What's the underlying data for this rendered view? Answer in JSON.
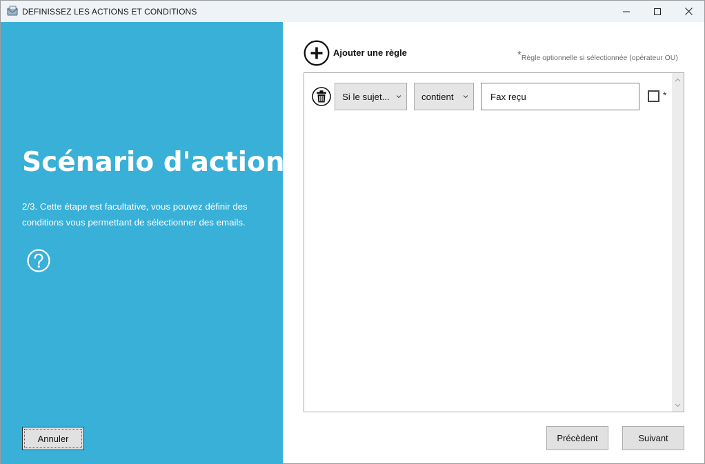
{
  "window": {
    "title": "DEFINISSEZ LES ACTIONS ET CONDITIONS",
    "controls": [
      "minimize-icon",
      "maximize-icon",
      "close-icon"
    ]
  },
  "left_panel": {
    "background_color": "#38b0d7",
    "title": "Scénario d'actions",
    "description": "2/3. Cette étape est facultative, vous pouvez définir des conditions vous permettant de sélectionner des emails.",
    "help_icon": "question-circle-icon",
    "cancel_label": "Annuler"
  },
  "right_panel": {
    "add_rule_label": "Ajouter une règle",
    "add_rule_icon": "plus-circle-icon",
    "optional_note_star": "*",
    "optional_note": "Règle optionnelle si sélectionnée (opérateur OU)",
    "rules": [
      {
        "delete_icon": "trash-icon",
        "field": "Si le sujet...",
        "operator": "contient",
        "value": "Fax reçu",
        "optional_checked": false,
        "optional_star": "*"
      }
    ],
    "prev_label": "Précèdent",
    "next_label": "Suivant"
  }
}
